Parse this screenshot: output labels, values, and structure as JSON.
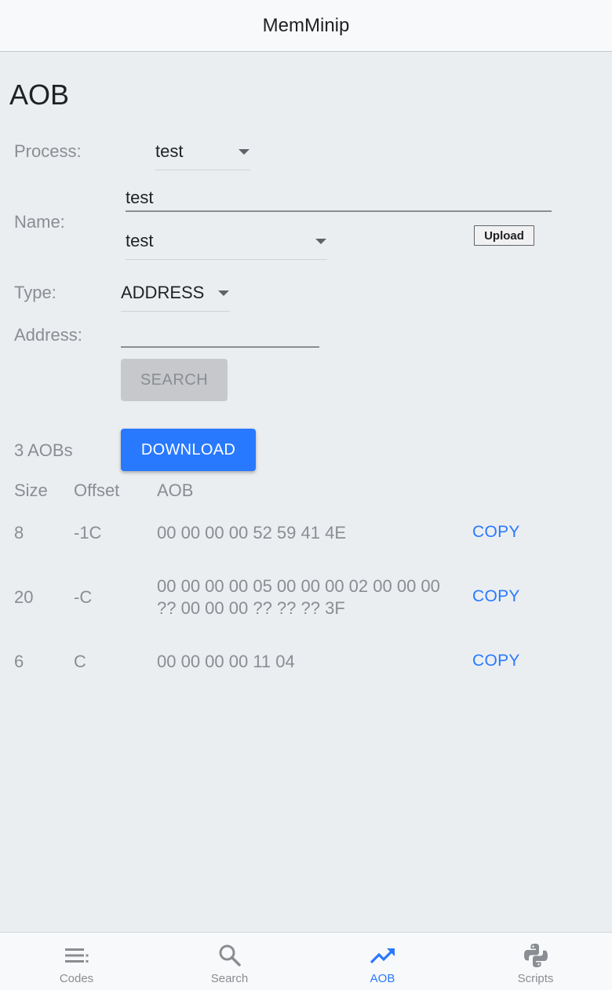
{
  "app": {
    "title": "MemMinip"
  },
  "page": {
    "title": "AOB"
  },
  "form": {
    "process_label": "Process:",
    "process_value": "test",
    "name_label": "Name:",
    "name_input_value": "test",
    "name_select_value": "test",
    "upload_label": "Upload",
    "type_label": "Type:",
    "type_value": "ADDRESS",
    "address_label": "Address:",
    "address_value": "",
    "search_label": "SEARCH"
  },
  "results": {
    "count_label": "3 AOBs",
    "download_label": "DOWNLOAD",
    "columns": {
      "size": "Size",
      "offset": "Offset",
      "aob": "AOB"
    },
    "copy_label": "COPY",
    "rows": [
      {
        "size": "8",
        "offset": "-1C",
        "aob": "00 00 00 00 52 59 41 4E"
      },
      {
        "size": "20",
        "offset": "-C",
        "aob": "00 00 00 00 05 00 00 00 02 00 00 00 ?? 00 00 00 ?? ?? ?? 3F"
      },
      {
        "size": "6",
        "offset": "C",
        "aob": "00 00 00 00 11 04"
      }
    ]
  },
  "nav": {
    "items": [
      {
        "label": "Codes",
        "icon": "list-icon"
      },
      {
        "label": "Search",
        "icon": "search-icon"
      },
      {
        "label": "AOB",
        "icon": "trending-up-icon"
      },
      {
        "label": "Scripts",
        "icon": "python-icon"
      }
    ],
    "active": "AOB"
  },
  "colors": {
    "accent": "#2979ff",
    "background": "#ebeef1",
    "muted_text": "#8a8d91"
  }
}
